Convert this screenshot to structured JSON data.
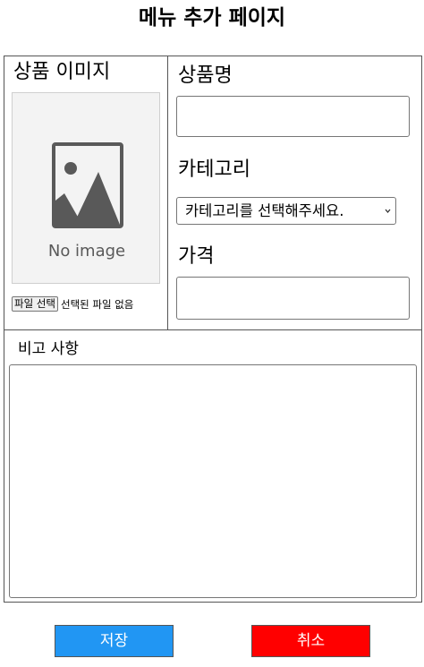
{
  "page": {
    "title": "메뉴 추가 페이지"
  },
  "image_section": {
    "label": "상품 이미지",
    "placeholder_text": "No image",
    "file_button_label": "파일 선택",
    "file_status": "선택된 파일 없음"
  },
  "fields": {
    "name_label": "상품명",
    "name_value": "",
    "category_label": "카테고리",
    "category_selected": "카테고리를 선택해주세요.",
    "price_label": "가격",
    "price_value": ""
  },
  "notes": {
    "label": "비고 사항",
    "value": ""
  },
  "actions": {
    "save_label": "저장",
    "cancel_label": "취소",
    "save_color": "#2196f3",
    "cancel_color": "#ff0000"
  },
  "icons": {
    "image_placeholder": "image-placeholder-icon",
    "select_arrow": "chevron-down-icon"
  }
}
